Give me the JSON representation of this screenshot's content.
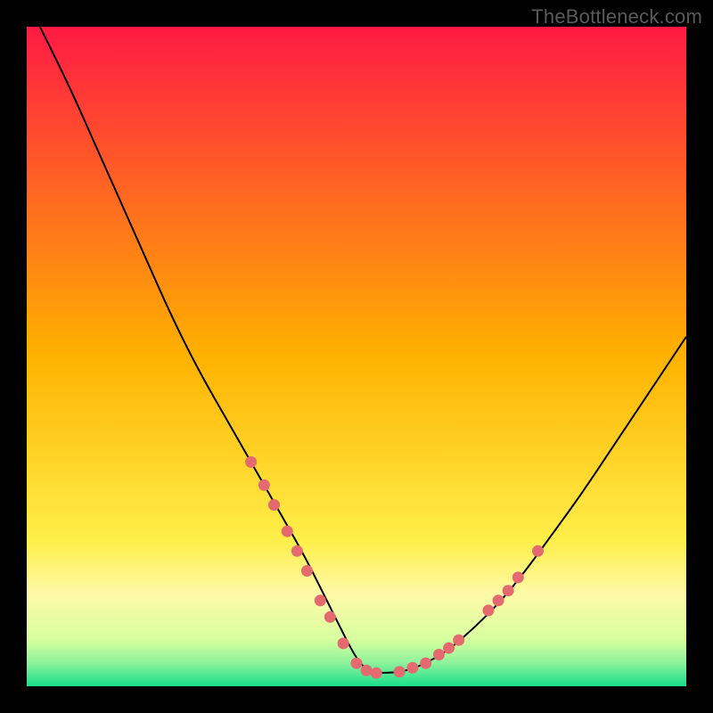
{
  "watermark": "TheBottleneck.com",
  "chart_data": {
    "type": "line",
    "title": "",
    "xlabel": "",
    "ylabel": "",
    "xlim": [
      0,
      100
    ],
    "ylim": [
      0,
      100
    ],
    "grid": false,
    "legend": false,
    "background_gradient": {
      "stops": [
        {
          "offset": 0.0,
          "color": "#ff1a44"
        },
        {
          "offset": 0.5,
          "color": "#ffb200"
        },
        {
          "offset": 0.78,
          "color": "#ffef4a"
        },
        {
          "offset": 0.86,
          "color": "#fff9a8"
        },
        {
          "offset": 0.93,
          "color": "#d6ff9e"
        },
        {
          "offset": 0.965,
          "color": "#8cf29b"
        },
        {
          "offset": 1.0,
          "color": "#17e08a"
        }
      ]
    },
    "series": [
      {
        "name": "curve",
        "color": "#000000",
        "width": 2,
        "x": [
          2,
          6,
          10,
          14,
          18,
          22,
          26,
          30,
          34,
          38,
          42,
          45,
          47,
          49,
          50.5,
          52,
          54,
          57,
          60,
          64,
          68,
          72,
          76,
          80,
          84,
          88,
          92,
          96,
          100
        ],
        "y": [
          100,
          92,
          83,
          74,
          65,
          56,
          48,
          41,
          34,
          27,
          20,
          14,
          10,
          6,
          3.5,
          2.2,
          2.0,
          2.2,
          3.2,
          5.5,
          9,
          13,
          18,
          23.5,
          29,
          35,
          41,
          47,
          53
        ]
      }
    ],
    "markers": {
      "color": "#e46a6f",
      "radius": 6.5,
      "points": [
        {
          "x": 34.0,
          "y": 34.0
        },
        {
          "x": 36.0,
          "y": 30.5
        },
        {
          "x": 37.5,
          "y": 27.5
        },
        {
          "x": 39.5,
          "y": 23.5
        },
        {
          "x": 41.0,
          "y": 20.5
        },
        {
          "x": 42.5,
          "y": 17.5
        },
        {
          "x": 44.5,
          "y": 13.0
        },
        {
          "x": 46.0,
          "y": 10.5
        },
        {
          "x": 48.0,
          "y": 6.5
        },
        {
          "x": 50.0,
          "y": 3.5
        },
        {
          "x": 51.5,
          "y": 2.4
        },
        {
          "x": 53.0,
          "y": 2.0
        },
        {
          "x": 56.5,
          "y": 2.2
        },
        {
          "x": 58.5,
          "y": 2.8
        },
        {
          "x": 60.5,
          "y": 3.5
        },
        {
          "x": 62.5,
          "y": 4.8
        },
        {
          "x": 64.0,
          "y": 5.8
        },
        {
          "x": 65.5,
          "y": 7.0
        },
        {
          "x": 70.0,
          "y": 11.5
        },
        {
          "x": 71.5,
          "y": 13.0
        },
        {
          "x": 73.0,
          "y": 14.5
        },
        {
          "x": 74.5,
          "y": 16.5
        },
        {
          "x": 77.5,
          "y": 20.5
        }
      ]
    }
  }
}
